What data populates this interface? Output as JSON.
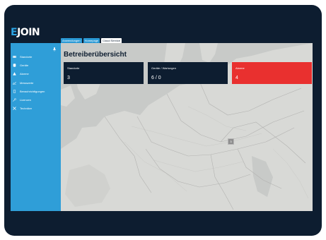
{
  "brand": {
    "logo_text": "EJOIN",
    "accent": "#2ba3e3",
    "dark": "#0d1d30",
    "alarm_color": "#e9302f"
  },
  "tabs": [
    {
      "label": "Anwendungen"
    },
    {
      "label": "Homepage"
    },
    {
      "label": "Cloud Service"
    }
  ],
  "sidebar": {
    "pin_icon": "pin-icon",
    "items": [
      {
        "label": "Standorte",
        "icon": "map-icon"
      },
      {
        "label": "Geräte",
        "icon": "database-icon"
      },
      {
        "label": "Alarme",
        "icon": "warning-icon"
      },
      {
        "label": "Messwerte",
        "icon": "chart-icon"
      },
      {
        "label": "Benachrichtigungen",
        "icon": "phone-icon"
      },
      {
        "label": "Lizenzen",
        "icon": "key-icon"
      },
      {
        "label": "Techniker",
        "icon": "wrench-icon"
      }
    ]
  },
  "main": {
    "title": "Betreiberübersicht",
    "cards": [
      {
        "label": "Standorte",
        "value": "3"
      },
      {
        "label": "Geräte / Wartungen",
        "value": "6 / 0"
      },
      {
        "label": "Alarme",
        "value": "4"
      }
    ],
    "map_marker": {
      "count": "3"
    }
  }
}
